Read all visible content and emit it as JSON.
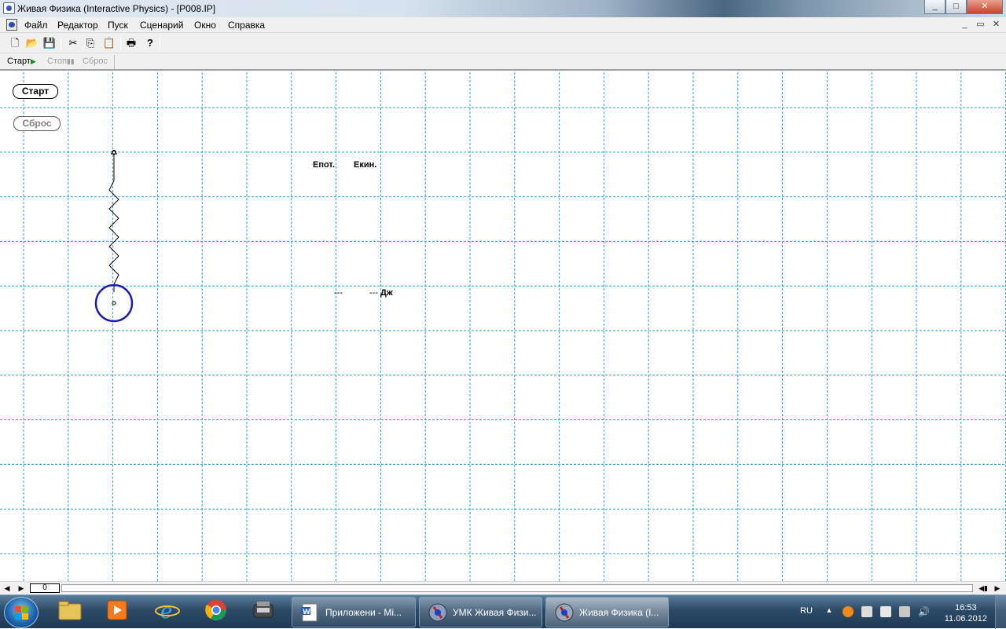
{
  "window": {
    "title": "Живая Физика (Interactive Physics) - [P008.IP]",
    "controls": [
      "_",
      "□",
      "✕"
    ]
  },
  "menu": {
    "items": [
      "Файл",
      "Редактор",
      "Пуск",
      "Сценарий",
      "Окно",
      "Справка"
    ],
    "mdi_controls": [
      "_",
      "▭",
      "✕"
    ]
  },
  "toolbar": {
    "buttons": [
      {
        "name": "new",
        "icon": "new-document-icon",
        "glyph": "🗋"
      },
      {
        "name": "open",
        "icon": "open-folder-icon",
        "glyph": "📂"
      },
      {
        "name": "save",
        "icon": "save-icon",
        "glyph": "💾"
      },
      {
        "name": "cut",
        "icon": "scissors-icon",
        "glyph": "✂"
      },
      {
        "name": "copy",
        "icon": "copy-icon",
        "glyph": "⎘"
      },
      {
        "name": "paste",
        "icon": "paste-icon",
        "glyph": "📋"
      },
      {
        "name": "print",
        "icon": "printer-icon",
        "glyph": "🖶"
      },
      {
        "name": "help",
        "icon": "help-icon",
        "glyph": "?"
      }
    ]
  },
  "controlbar": {
    "start": "Старт",
    "stop": "Стоп",
    "reset": "Сброс"
  },
  "workspace": {
    "start_button": "Старт",
    "reset_button": "Сброс",
    "label_epot": "Епот.",
    "label_ekin": "Екин.",
    "value_epot": "---",
    "value_ekin": "---",
    "unit": "Дж",
    "grid_color": "#2aa0d8",
    "ball_color": "#1c1cae"
  },
  "scrollbar": {
    "frame": "0"
  },
  "taskbar": {
    "tasks": [
      {
        "label": "Приложени - Mi...",
        "icon": "word-icon"
      },
      {
        "label": "УМК Живая Физи...",
        "icon": "physics-icon"
      },
      {
        "label": "Живая Физика (I...",
        "icon": "physics-icon"
      }
    ],
    "lang": "RU",
    "time": "16:53",
    "date": "11.06.2012"
  }
}
